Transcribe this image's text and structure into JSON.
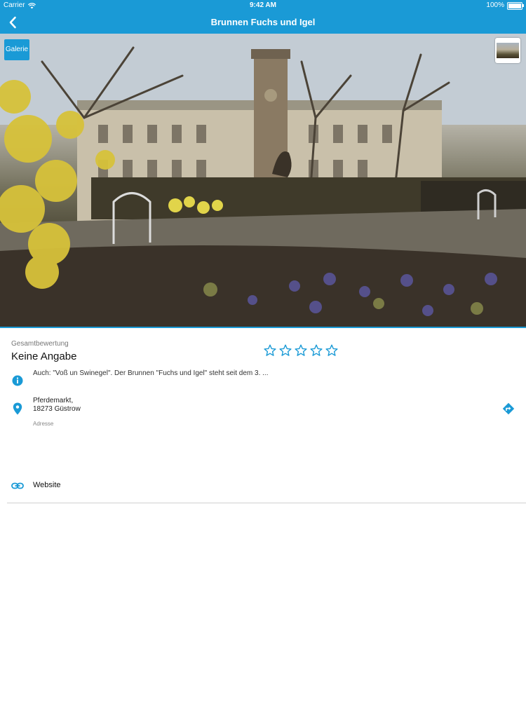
{
  "status_bar": {
    "carrier": "Carrier",
    "time": "9:42 AM",
    "battery": "100%",
    "battery_level": 1.0
  },
  "nav": {
    "title": "Brunnen Fuchs und Igel",
    "back_icon": "chevron-left-icon"
  },
  "hero": {
    "gallery_button": "Galerie"
  },
  "rating": {
    "caption": "Gesamtbewertung",
    "value": "Keine Angabe",
    "stars_total": 5,
    "stars_filled": 0
  },
  "info": {
    "text": "Auch: \"Voß un Swinegel\". Der Brunnen \"Fuchs und Igel\" steht seit dem 3. ..."
  },
  "address": {
    "line1": "Pferdemarkt,",
    "line2": "18273 Güstrow",
    "caption": "Adresse"
  },
  "website": {
    "label": "Website"
  },
  "colors": {
    "accent": "#1a9ad6"
  }
}
